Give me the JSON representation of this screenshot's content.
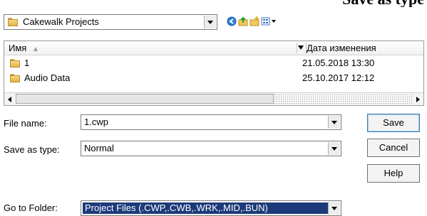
{
  "caption": "Save as type",
  "look_in": {
    "value": "Cakewalk Projects"
  },
  "toolbar": {
    "icons": [
      "back-icon",
      "up-folder-icon",
      "new-folder-icon",
      "view-menu-icon"
    ]
  },
  "columns": {
    "name": "Имя",
    "date": "Дата изменения"
  },
  "files": [
    {
      "name": "1",
      "date": "21.05.2018 13:30"
    },
    {
      "name": "Audio Data",
      "date": "25.10.2017 12:12"
    }
  ],
  "form": {
    "file_name_label": "File name:",
    "file_name_value": "1.cwp",
    "save_as_type_label": "Save as type:",
    "save_as_type_value": "Normal",
    "go_to_folder_label": "Go to Folder:",
    "go_to_folder_value": "Project Files (.CWP,.CWB,.WRK,.MID,.BUN)"
  },
  "buttons": {
    "save": "Save",
    "cancel": "Cancel",
    "help": "Help"
  },
  "colors": {
    "selection": "#1c3a7a",
    "default_button_border": "#3c7fb1"
  }
}
